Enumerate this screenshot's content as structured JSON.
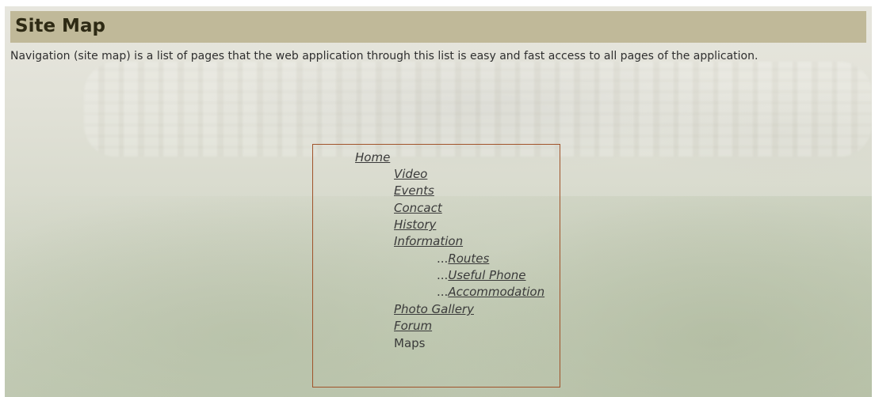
{
  "page": {
    "title": "Site Map",
    "description": "Navigation (site map) is a list of pages that the web application through this list is easy and fast access to all pages of the application."
  },
  "sitemap": {
    "home": "Home",
    "items": [
      {
        "label": "Video"
      },
      {
        "label": "Events"
      },
      {
        "label": "Concact"
      },
      {
        "label": "History"
      },
      {
        "label": "Information"
      }
    ],
    "sub_prefix": "...",
    "sub_items": [
      {
        "label": "Routes"
      },
      {
        "label": "Useful Phone"
      },
      {
        "label": "Accommodation"
      }
    ],
    "more_items": [
      {
        "label": "Photo Gallery"
      },
      {
        "label": "Forum"
      }
    ],
    "maps_label": "Maps"
  },
  "colors": {
    "title_bar": "#c0b999",
    "box_border": "#a0532a",
    "text": "#3a3a3a"
  }
}
